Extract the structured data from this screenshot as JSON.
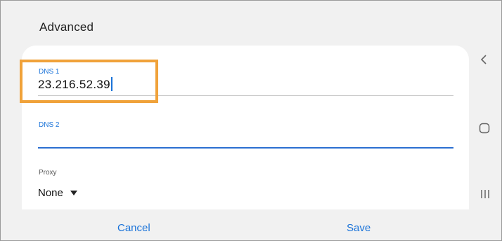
{
  "dialog": {
    "title": "Advanced"
  },
  "fields": {
    "dns1": {
      "label": "DNS 1",
      "value": "23.216.52.39"
    },
    "dns2": {
      "label": "DNS 2",
      "value": ""
    },
    "proxy": {
      "label": "Proxy",
      "value": "None"
    }
  },
  "buttons": {
    "cancel_label": "Cancel",
    "save_label": "Save"
  },
  "nav": {
    "back_icon": "chevron-left-icon",
    "home_icon": "home-icon",
    "recents_icon": "recents-icon"
  },
  "colors": {
    "accent": "#1a73d9",
    "highlight": "#f0a23a",
    "dialog_background": "#f1f1f1"
  }
}
